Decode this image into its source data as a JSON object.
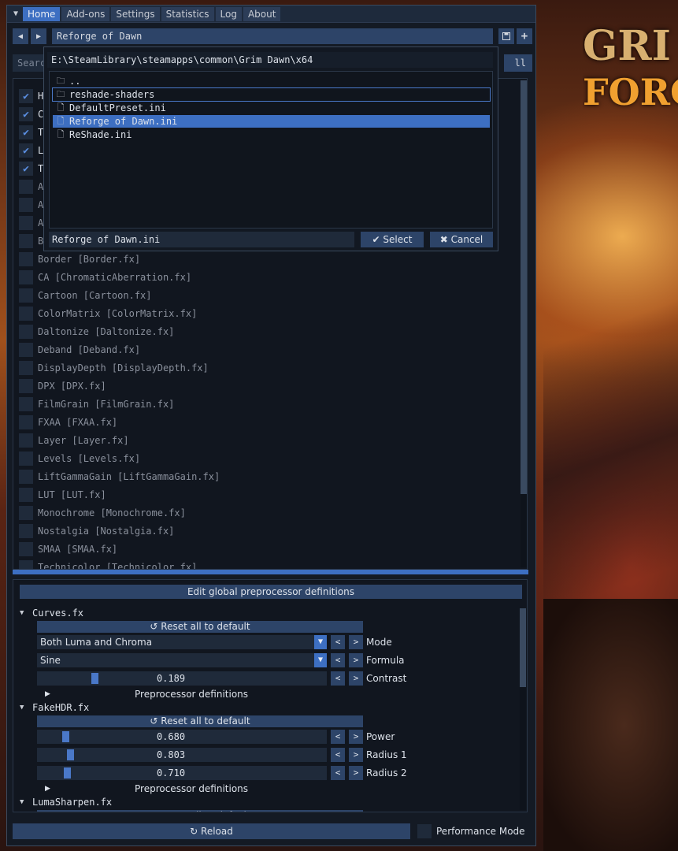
{
  "menu": {
    "items": [
      "Home",
      "Add-ons",
      "Settings",
      "Statistics",
      "Log",
      "About"
    ],
    "active_index": 0
  },
  "preset": {
    "name": "Reforge of Dawn",
    "prev_icon": "arrow-left-icon",
    "next_icon": "arrow-right-icon",
    "save_icon": "save-icon",
    "add_icon": "plus-icon"
  },
  "search": {
    "placeholder": "Search",
    "toggle_all_label": "ll"
  },
  "effects": [
    {
      "label": "H",
      "enabled": true
    },
    {
      "label": "C",
      "enabled": true
    },
    {
      "label": "T",
      "enabled": true
    },
    {
      "label": "LumaSharpen [LumaSharpen.fx]",
      "enabled": true
    },
    {
      "label": "Tint [Sepia.fx]",
      "enabled": true
    },
    {
      "label": "AdvancedCRT [CRT.fx]",
      "enabled": false
    },
    {
      "label": "Aspect [SplitScreen.fx]",
      "enabled": false
    },
    {
      "label": "ASCII [ASCII.fx]",
      "enabled": false
    },
    {
      "label": "B",
      "enabled": false
    },
    {
      "label": "Border [Border.fx]",
      "enabled": false
    },
    {
      "label": "CA [ChromaticAberration.fx]",
      "enabled": false
    },
    {
      "label": "Cartoon [Cartoon.fx]",
      "enabled": false
    },
    {
      "label": "ColorMatrix [ColorMatrix.fx]",
      "enabled": false
    },
    {
      "label": "Daltonize [Daltonize.fx]",
      "enabled": false
    },
    {
      "label": "Deband [Deband.fx]",
      "enabled": false
    },
    {
      "label": "DisplayDepth [DisplayDepth.fx]",
      "enabled": false
    },
    {
      "label": "DPX [DPX.fx]",
      "enabled": false
    },
    {
      "label": "FilmGrain [FilmGrain.fx]",
      "enabled": false
    },
    {
      "label": "FXAA [FXAA.fx]",
      "enabled": false
    },
    {
      "label": "Layer [Layer.fx]",
      "enabled": false
    },
    {
      "label": "Levels [Levels.fx]",
      "enabled": false
    },
    {
      "label": "LiftGammaGain [LiftGammaGain.fx]",
      "enabled": false
    },
    {
      "label": "LUT [LUT.fx]",
      "enabled": false
    },
    {
      "label": "Monochrome [Monochrome.fx]",
      "enabled": false
    },
    {
      "label": "Nostalgia [Nostalgia.fx]",
      "enabled": false
    },
    {
      "label": "SMAA [SMAA.fx]",
      "enabled": false
    },
    {
      "label": "Technicolor [Technicolor.fx]",
      "enabled": false
    }
  ],
  "settings": {
    "header_button": "Edit global preprocessor definitions",
    "reset_label": "Reset all to default",
    "preprocessor_label": "Preprocessor definitions",
    "curves": {
      "title": "Curves.fx",
      "mode_value": "Both Luma and Chroma",
      "mode_label": "Mode",
      "formula_value": "Sine",
      "formula_label": "Formula",
      "contrast_value": "0.189",
      "contrast_label": "Contrast",
      "contrast_level": 0.189
    },
    "fakehdr": {
      "title": "FakeHDR.fx",
      "power_value": "0.680",
      "power_label": "Power",
      "power_level": 0.085,
      "radius1_value": "0.803",
      "radius1_label": "Radius 1",
      "radius1_level": 0.1,
      "radius2_value": "0.710",
      "radius2_label": "Radius 2",
      "radius2_level": 0.089
    },
    "lumasharpen": {
      "title": "LumaSharpen.fx"
    }
  },
  "footer": {
    "reload_label": "Reload",
    "performance_label": "Performance Mode"
  },
  "dialog": {
    "path": "E:\\SteamLibrary\\steamapps\\common\\Grim Dawn\\x64",
    "files": [
      {
        "name": "..",
        "type": "folder"
      },
      {
        "name": "reshade-shaders",
        "type": "folder"
      },
      {
        "name": "DefaultPreset.ini",
        "type": "file"
      },
      {
        "name": "Reforge of Dawn.ini",
        "type": "file"
      },
      {
        "name": "ReShade.ini",
        "type": "file"
      }
    ],
    "focused_index": 1,
    "selected_index": 3,
    "filename": "Reforge of Dawn.ini",
    "select_label": "Select",
    "cancel_label": "Cancel"
  },
  "background": {
    "logo_line1": "GRI",
    "logo_line2": "FORG"
  },
  "colors": {
    "accent": "#3d6fc2",
    "button": "#2d4468",
    "panel": "#141a24"
  }
}
